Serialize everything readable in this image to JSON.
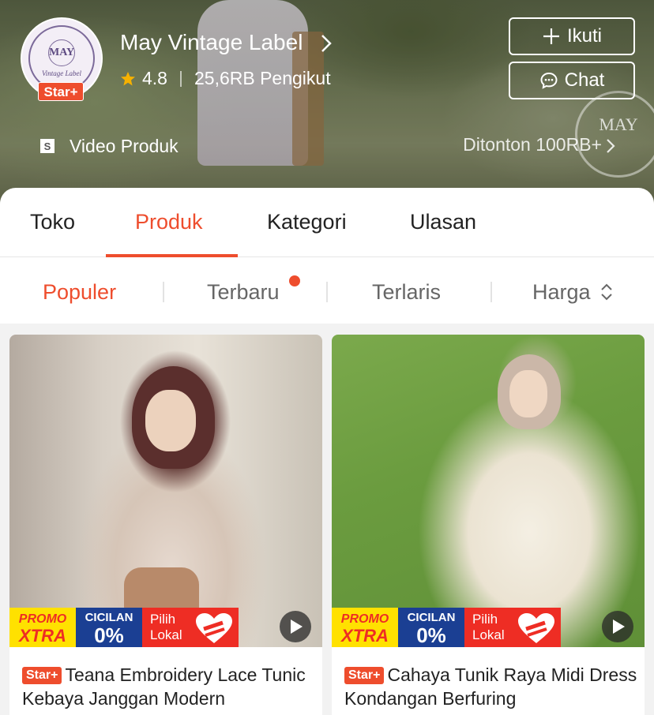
{
  "shop": {
    "name": "May Vintage Label",
    "logo_text_main": "MAY",
    "logo_text_sub": "Vintage Label",
    "badge": "Star+",
    "rating": "4.8",
    "followers": "25,6RB Pengikut",
    "watermark": "MAY"
  },
  "actions": {
    "follow_label": "Ikuti",
    "chat_label": "Chat"
  },
  "video": {
    "label": "Video Produk",
    "views": "Ditonton 100RB+"
  },
  "tabs": [
    {
      "label": "Toko"
    },
    {
      "label": "Produk"
    },
    {
      "label": "Kategori"
    },
    {
      "label": "Ulasan"
    }
  ],
  "active_tab": "Produk",
  "sort": [
    {
      "label": "Populer"
    },
    {
      "label": "Terbaru"
    },
    {
      "label": "Terlaris"
    },
    {
      "label": "Harga"
    }
  ],
  "active_sort": "Populer",
  "promo_banner": {
    "promo": "PROMO",
    "xtra": "XTRA",
    "cicilan": "CICILAN",
    "zero": "0%",
    "pilih": "Pilih",
    "lokal": "Lokal"
  },
  "products": [
    {
      "badge": "Star+",
      "title": "Teana Embroidery Lace Tunic Kebaya Janggan Modern"
    },
    {
      "badge": "Star+",
      "title": "Cahaya Tunik Raya Midi Dress Kondangan Berfuring"
    }
  ],
  "colors": {
    "accent": "#ee4d2d",
    "cicilan_blue": "#1b3f93",
    "xtra_yellow": "#ffe100"
  }
}
